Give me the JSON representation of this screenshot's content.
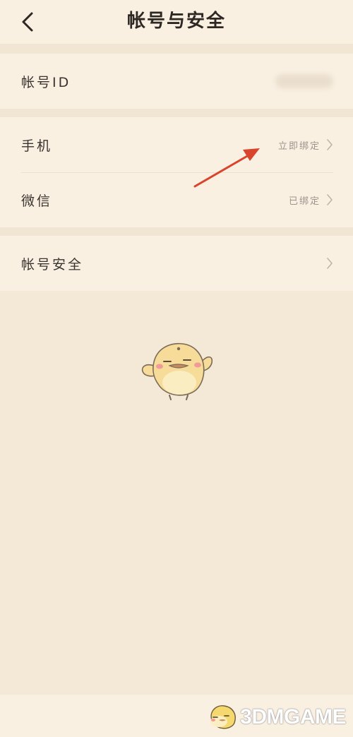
{
  "nav": {
    "title": "帐号与安全",
    "back_icon": "chevron-left-icon"
  },
  "sections": [
    {
      "rows": [
        {
          "label": "帐号ID",
          "value": ""
        }
      ]
    },
    {
      "rows": [
        {
          "label": "手机",
          "value": "立即绑定"
        },
        {
          "label": "微信",
          "value": "已绑定"
        }
      ]
    },
    {
      "rows": [
        {
          "label": "帐号安全",
          "value": ""
        }
      ]
    }
  ],
  "watermark": {
    "text": "3DMGAME"
  },
  "colors": {
    "background": "#f4e8d6",
    "card": "#faf0e2",
    "arrow": "#d8442c",
    "mascot": "#f6dc98"
  }
}
